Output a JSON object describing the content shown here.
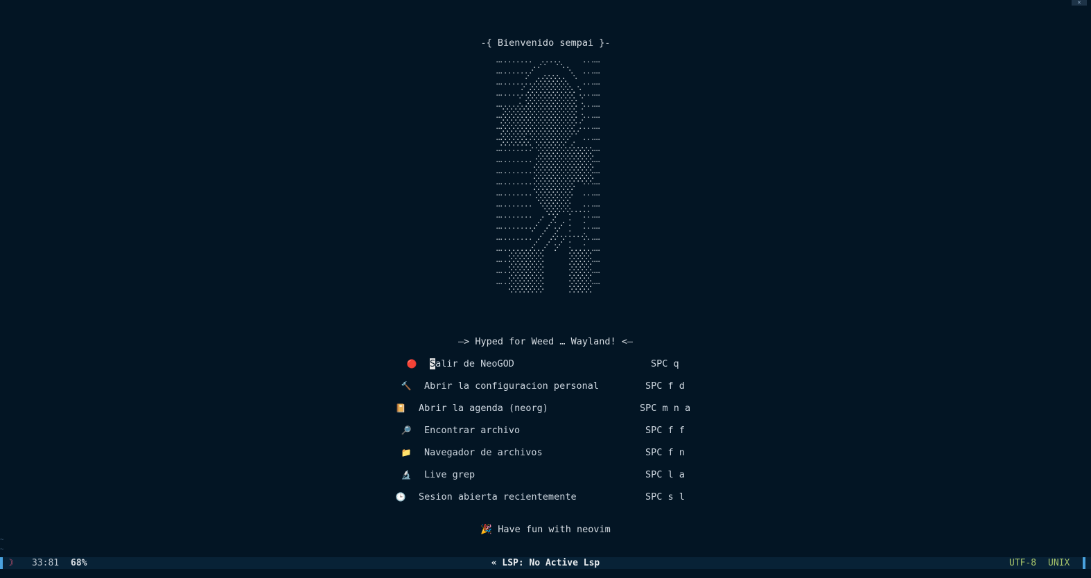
{
  "header": {
    "title": "-{ Bienvenido sempai }-"
  },
  "tagline": "—> Hyped for Weed … Wayland! <—",
  "menu": [
    {
      "icon": "red-circle-icon",
      "glyph": "🔴",
      "label_first": "S",
      "label_rest": "alir de NeoGOD",
      "keys": "SPC q"
    },
    {
      "icon": "hammer-icon",
      "glyph": "🔨",
      "label": "Abrir la configuracion personal",
      "keys": "SPC f d"
    },
    {
      "icon": "notebook-icon",
      "glyph": "📔",
      "label": "Abrir la agenda (neorg)",
      "keys": "SPC m n a"
    },
    {
      "icon": "magnifier-icon",
      "glyph": "🔎",
      "label": "Encontrar archivo",
      "keys": "SPC f f"
    },
    {
      "icon": "folder-icon",
      "glyph": "📁",
      "label": "Navegador de archivos",
      "keys": "SPC f n"
    },
    {
      "icon": "microscope-icon",
      "glyph": "🔬",
      "label": "Live grep",
      "keys": "SPC l a"
    },
    {
      "icon": "clock-icon",
      "glyph": "🕒",
      "label": "Sesion abierta recientemente",
      "keys": "SPC s l"
    }
  ],
  "footer": {
    "glyph": "🎉",
    "text": "Have fun with neovim"
  },
  "statusbar": {
    "mode_icon": "moon-icon",
    "mode_glyph": "☽",
    "position": "33:81",
    "percent": "68%",
    "lsp": "« LSP: No Active Lsp",
    "encoding": "UTF-8",
    "format": "UNIX"
  },
  "colors": {
    "background": "#031524",
    "statusbar_bg": "#082236",
    "accent_blue": "#4aa3df",
    "encoding_green": "#a7c46a",
    "mode_red": "#e05a7a"
  }
}
